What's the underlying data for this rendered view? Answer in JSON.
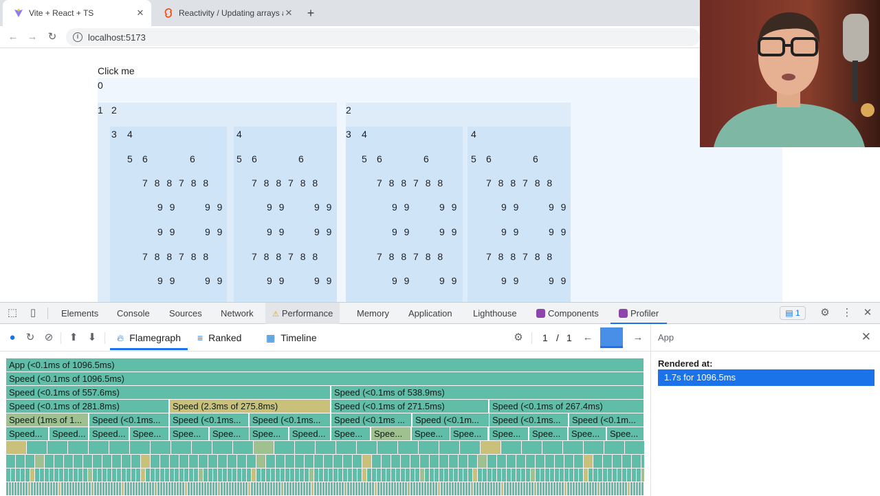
{
  "browser": {
    "tabs": [
      {
        "title": "Vite + React + TS",
        "active": true,
        "icon": "vite-icon"
      },
      {
        "title": "Reactivity / Updating arrays an",
        "active": false,
        "icon": "svelte-icon"
      }
    ],
    "url": "localhost:5173"
  },
  "page": {
    "button_text": "Click me",
    "counter": "0",
    "row1": [
      "1",
      "2",
      "2"
    ],
    "row2": [
      "3",
      "4",
      "4",
      "3",
      "4",
      "4"
    ],
    "row3": [
      "5",
      "6",
      "6",
      "5",
      "6",
      "6",
      "5",
      "6",
      "6",
      "5",
      "6",
      "6"
    ],
    "row_7_8": "7 8 8 7 8 8",
    "row_9": "9 9",
    "row9_pairs": 8
  },
  "devtools": {
    "tabs": [
      "Elements",
      "Console",
      "Sources",
      "Network",
      "Performance",
      "Memory",
      "Application",
      "Lighthouse",
      "Components",
      "Profiler"
    ],
    "hovered_tab": "Performance",
    "selected_tab": "Profiler",
    "message_count": "1",
    "profiler": {
      "view_tabs": [
        "Flamegraph",
        "Ranked",
        "Timeline"
      ],
      "selected_view": "Flamegraph",
      "commit_index": "1",
      "commit_separator": "/",
      "commit_total": "1",
      "sidebar_title": "App",
      "rendered_at_label": "Rendered at:",
      "rendered_at_value": "1.7s for 1096.5ms",
      "flame_rows": [
        [
          {
            "label": "App (<0.1ms of 1096.5ms)",
            "color": "#5fbda8"
          }
        ],
        [
          {
            "label": "Speed (<0.1ms of 1096.5ms)",
            "color": "#5fbda8"
          }
        ],
        [
          {
            "label": "Speed (<0.1ms of 557.6ms)",
            "color": "#5fbda8"
          },
          {
            "label": "Speed (<0.1ms of 538.9ms)",
            "color": "#5fbda8"
          }
        ],
        [
          {
            "label": "Speed (<0.1ms of 281.8ms)",
            "color": "#5fbda8"
          },
          {
            "label": "Speed (2.3ms of 275.8ms)",
            "color": "#c9c07a"
          },
          {
            "label": "Speed (<0.1ms of 271.5ms)",
            "color": "#5fbda8"
          },
          {
            "label": "Speed (<0.1ms of 267.4ms)",
            "color": "#5fbda8"
          }
        ],
        [
          {
            "label": "Speed (1ms of 1...",
            "color": "#9fc18f"
          },
          {
            "label": "Speed (<0.1ms...",
            "color": "#5fbda8"
          },
          {
            "label": "Speed (<0.1ms...",
            "color": "#5fbda8"
          },
          {
            "label": "Speed (<0.1ms...",
            "color": "#5fbda8"
          },
          {
            "label": "Speed (<0.1ms ...",
            "color": "#5fbda8"
          },
          {
            "label": "Speed (<0.1m...",
            "color": "#5fbda8"
          },
          {
            "label": "Speed (<0.1ms...",
            "color": "#5fbda8"
          },
          {
            "label": "Speed (<0.1m...",
            "color": "#5fbda8"
          }
        ],
        [
          {
            "label": "Speed...",
            "color": "#5fbda8"
          },
          {
            "label": "Speed...",
            "color": "#5fbda8"
          },
          {
            "label": "Speed...",
            "color": "#5fbda8"
          },
          {
            "label": "Spee...",
            "color": "#5fbda8"
          },
          {
            "label": "Spee...",
            "color": "#5fbda8"
          },
          {
            "label": "Spee...",
            "color": "#5fbda8"
          },
          {
            "label": "Spee...",
            "color": "#5fbda8"
          },
          {
            "label": "Speed...",
            "color": "#5fbda8"
          },
          {
            "label": "Spee...",
            "color": "#5fbda8"
          },
          {
            "label": "Spee...",
            "color": "#9fc18f"
          },
          {
            "label": "Spee...",
            "color": "#5fbda8"
          },
          {
            "label": "Spee...",
            "color": "#5fbda8"
          },
          {
            "label": "Spee...",
            "color": "#5fbda8"
          },
          {
            "label": "Spee...",
            "color": "#5fbda8"
          },
          {
            "label": "Spee...",
            "color": "#5fbda8"
          },
          {
            "label": "Spee...",
            "color": "#5fbda8"
          }
        ]
      ]
    }
  },
  "colors": {
    "flame_default": "#5fbda8",
    "flame_hot": "#c9c07a",
    "flame_warm": "#9fc18f",
    "accent": "#1a73e8"
  }
}
